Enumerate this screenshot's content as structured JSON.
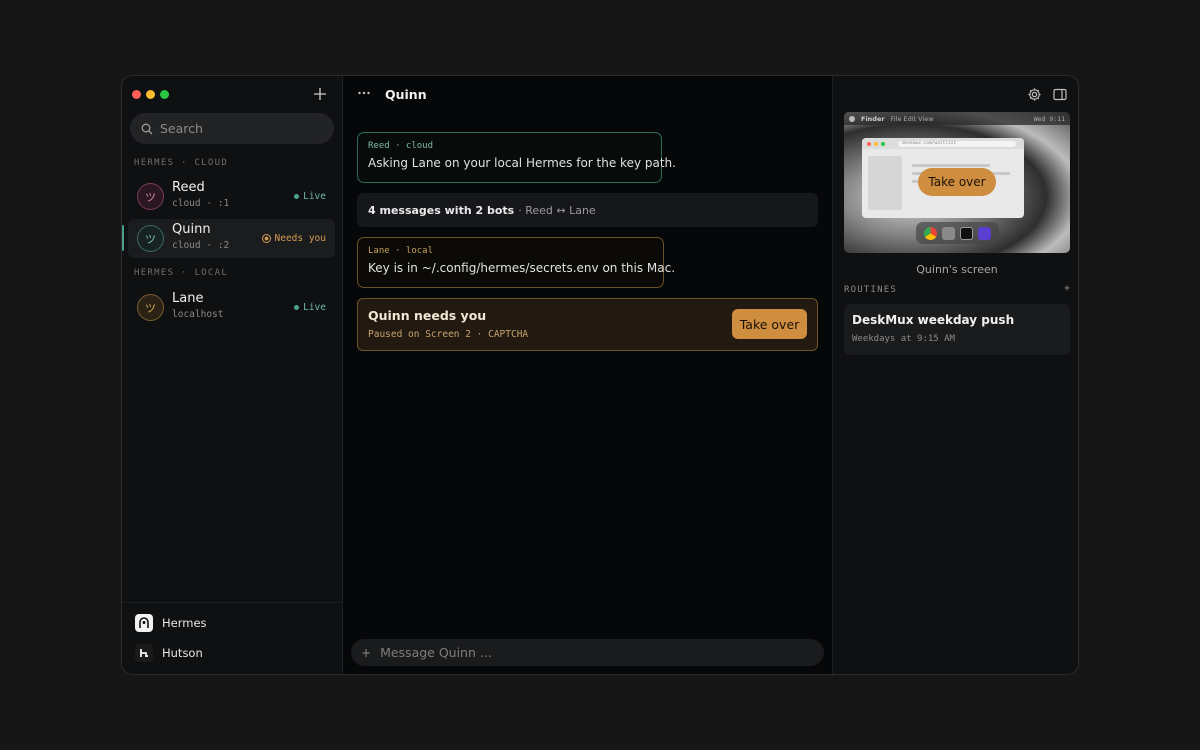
{
  "sidebar": {
    "search_placeholder": "Search",
    "sections": [
      {
        "title": "HERMES · CLOUD"
      },
      {
        "title": "HERMES · LOCAL"
      }
    ],
    "bots": [
      {
        "name": "Reed",
        "sub": "cloud · :1",
        "status": "Live",
        "avatar_glyph": "ツ",
        "color": "#d58aa5"
      },
      {
        "name": "Quinn",
        "sub": "cloud · :2",
        "status": "Needs you",
        "avatar_glyph": "ツ",
        "color": "#7fc1b5"
      },
      {
        "name": "Lane",
        "sub": "localhost",
        "status": "Live",
        "avatar_glyph": "ツ",
        "color": "#d4a55a"
      }
    ],
    "footer": [
      {
        "label": "Hermes",
        "icon": "hermes-logo-icon"
      },
      {
        "label": "Hutson",
        "icon": "hutson-logo-icon"
      }
    ]
  },
  "main": {
    "title": "Quinn",
    "messages": [
      {
        "meta": "Reed · cloud",
        "text": "Asking Lane on your local Hermes for the key path."
      },
      {
        "meta": "Lane · local",
        "text": "Key is in ~/.config/hermes/secrets.env on this Mac."
      }
    ],
    "summary": {
      "bold": "4 messages with 2 bots",
      "rest": "· Reed ↔ Lane"
    },
    "alert": {
      "title": "Quinn needs you",
      "sub": "Paused on Screen 2 · CAPTCHA",
      "button": "Take over"
    },
    "composer": {
      "plus": "+",
      "placeholder": "Message Quinn ..."
    }
  },
  "right": {
    "screen": {
      "menubar_app": "Finder",
      "menubar_menus": "File Edit View",
      "menubar_clock": "Wed 9:11",
      "url": "deskmux.com/waitlist",
      "button": "Take over",
      "caption": "Quinn's screen"
    },
    "routines": {
      "title": "ROUTINES",
      "add": "+",
      "items": [
        {
          "name": "DeskMux weekday push",
          "schedule": "Weekdays at 9:15 AM"
        }
      ]
    }
  },
  "colors": {
    "accent": "#cf8e3f",
    "live": "#4ea58e",
    "background": "#060708"
  }
}
